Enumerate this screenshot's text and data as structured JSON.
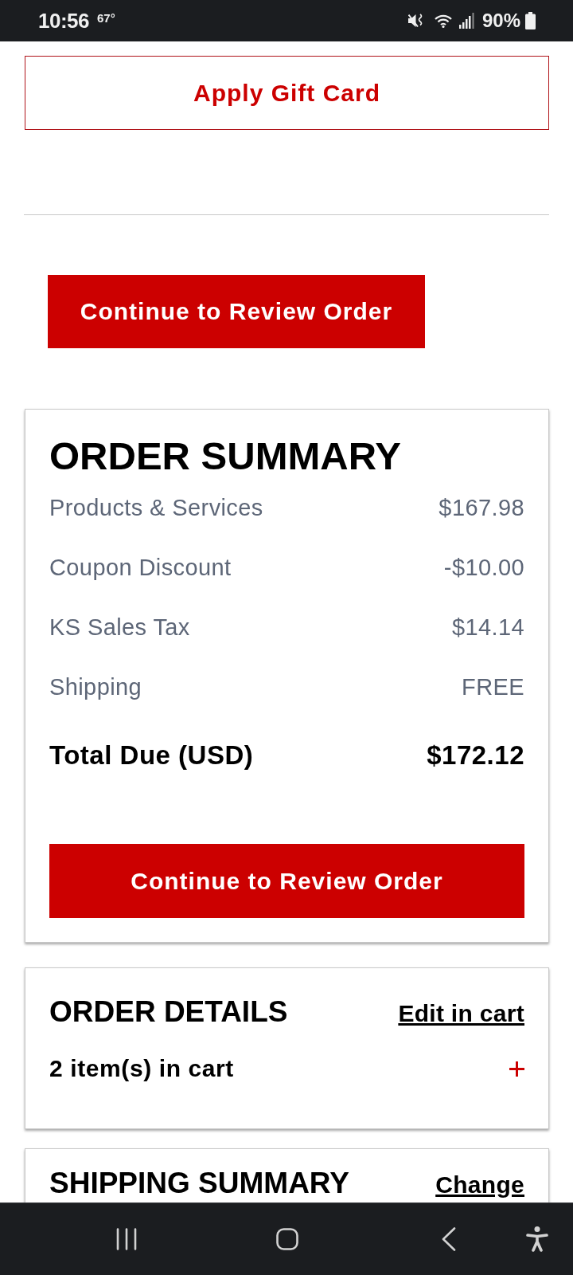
{
  "status_bar": {
    "time": "10:56",
    "temperature": "67°",
    "battery": "90%"
  },
  "gift_card_button": {
    "label": "Apply Gift Card"
  },
  "review_button": {
    "label": "Continue to Review Order"
  },
  "order_summary": {
    "title": "ORDER SUMMARY",
    "lines": [
      {
        "label": "Products & Services",
        "value": "$167.98"
      },
      {
        "label": "Coupon Discount",
        "value": "-$10.00"
      },
      {
        "label": "KS Sales Tax",
        "value": "$14.14"
      },
      {
        "label": "Shipping",
        "value": "FREE"
      }
    ],
    "total": {
      "label": "Total Due (USD)",
      "value": "$172.12"
    },
    "button": {
      "label": "Continue to Review Order"
    }
  },
  "order_details": {
    "title": "ORDER DETAILS",
    "link": "Edit in cart",
    "items": "2 item(s) in cart",
    "expanded": false
  },
  "shipping_summary": {
    "title": "SHIPPING SUMMARY",
    "link": "Change"
  }
}
